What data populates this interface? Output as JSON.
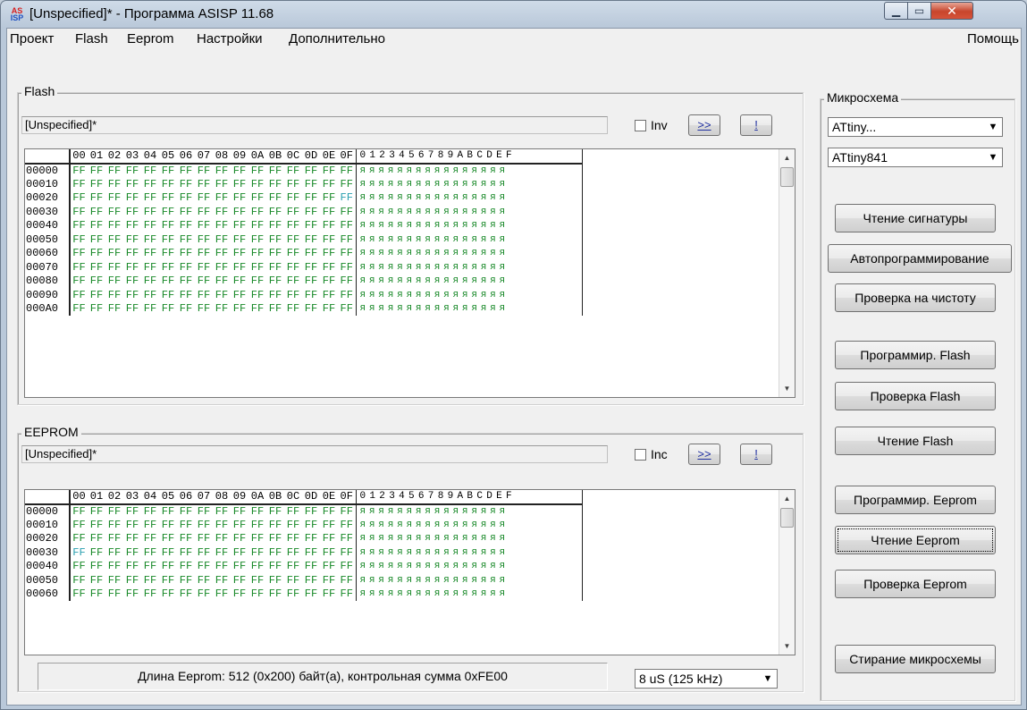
{
  "window": {
    "title": "[Unspecified]* - Программа ASISP 11.68",
    "icon_text_top": "AS",
    "icon_text_bottom": "ISP",
    "minimize_glyph": "▁",
    "maximize_glyph": "▭",
    "close_glyph": "✕"
  },
  "menu": {
    "items": [
      "Проект",
      "Flash",
      "Eeprom",
      "Настройки",
      "Дополнительно"
    ],
    "help": "Помощь"
  },
  "flash": {
    "group_title": "Flash",
    "path": "[Unspecified]*",
    "checkbox_label": "Inv",
    "btn_next": ">>",
    "btn_bang": "!",
    "header_cols": [
      "00",
      "01",
      "02",
      "03",
      "04",
      "05",
      "06",
      "07",
      "08",
      "09",
      "0A",
      "0B",
      "0C",
      "0D",
      "0E",
      "0F"
    ],
    "header_ascii": "0123456789ABCDEF",
    "addresses": [
      "00000",
      "00010",
      "00020",
      "00030",
      "00040",
      "00050",
      "00060",
      "00070",
      "00080",
      "00090",
      "000A0"
    ],
    "cell_value": "FF",
    "ascii_row": "яяяяяяяяяяяяяяяя",
    "highlight": {
      "row": 2,
      "col": 15
    }
  },
  "eeprom": {
    "group_title": "EEPROM",
    "path": "[Unspecified]*",
    "checkbox_label": "Inc",
    "btn_next": ">>",
    "btn_bang": "!",
    "header_cols": [
      "00",
      "01",
      "02",
      "03",
      "04",
      "05",
      "06",
      "07",
      "08",
      "09",
      "0A",
      "0B",
      "0C",
      "0D",
      "0E",
      "0F"
    ],
    "header_ascii": "0123456789ABCDEF",
    "addresses": [
      "00000",
      "00010",
      "00020",
      "00030",
      "00040",
      "00050",
      "00060"
    ],
    "cell_value": "FF",
    "ascii_row": "яяяяяяяяяяяяяяяя",
    "highlight": {
      "row": 3,
      "col": 0
    }
  },
  "status": {
    "text": "Длина Eeprom:  512 (0x200) байт(а), контрольная сумма 0xFE00",
    "speed": "8 uS  (125 kHz)"
  },
  "chip": {
    "group_title": "Микросхема",
    "family": "ATtiny...",
    "model": "ATtiny841",
    "buttons": {
      "read_signature": "Чтение сигнатуры",
      "autoprogram": "Автопрограммирование",
      "blank_check": "Проверка на чистоту",
      "program_flash": "Программир. Flash",
      "verify_flash": "Проверка Flash",
      "read_flash": "Чтение Flash",
      "program_eeprom": "Программир. Eeprom",
      "read_eeprom": "Чтение Eeprom",
      "verify_eeprom": "Проверка Eeprom",
      "erase_chip": "Стирание микросхемы"
    }
  }
}
